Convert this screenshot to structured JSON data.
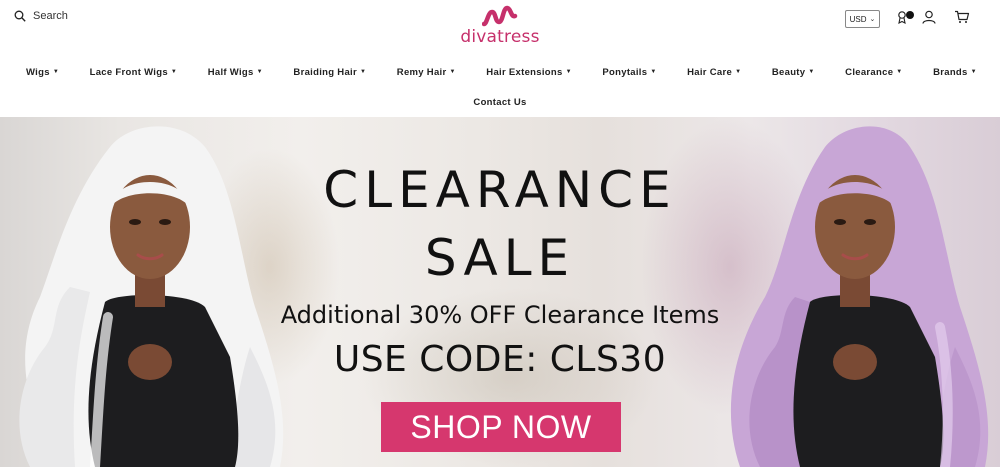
{
  "header": {
    "search_label": "Search",
    "logo_text": "divatress",
    "currency": "USD",
    "brand_color": "#c6306b",
    "icons": [
      "search-icon",
      "rewards-icon",
      "account-icon",
      "cart-icon",
      "chevron-down-icon"
    ]
  },
  "nav": {
    "items": [
      {
        "label": "Wigs"
      },
      {
        "label": "Lace Front Wigs"
      },
      {
        "label": "Half Wigs"
      },
      {
        "label": "Braiding Hair"
      },
      {
        "label": "Remy Hair"
      },
      {
        "label": "Hair Extensions"
      },
      {
        "label": "Ponytails"
      },
      {
        "label": "Hair Care"
      },
      {
        "label": "Beauty"
      },
      {
        "label": "Clearance"
      },
      {
        "label": "Brands"
      }
    ],
    "secondary": {
      "label": "Contact Us"
    }
  },
  "hero": {
    "headline_line1": "CLEARANCE",
    "headline_line2": "SALE",
    "offer": "Additional 30% OFF Clearance Items",
    "code": "USE CODE: CLS30",
    "cta": "SHOP NOW",
    "cta_color": "#d6376e"
  }
}
